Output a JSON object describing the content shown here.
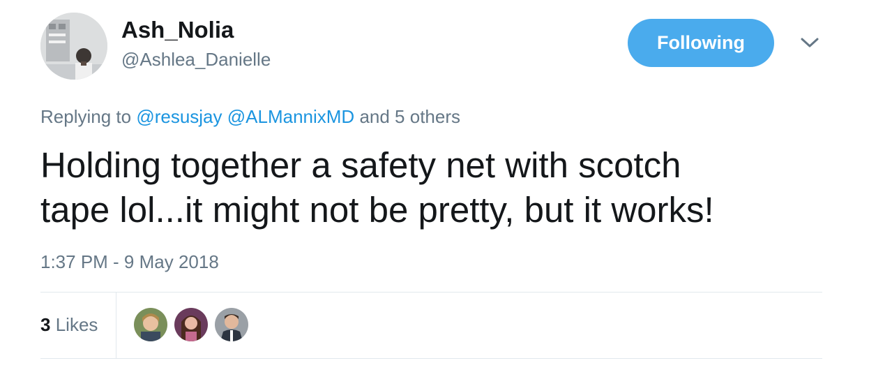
{
  "author": {
    "name": "Ash_Nolia",
    "handle": "@Ashlea_Danielle"
  },
  "follow_button": {
    "label": "Following"
  },
  "reply": {
    "prefix": "Replying to",
    "mention_1": "@resusjay",
    "mention_2": "@ALMannixMD",
    "suffix": "and 5 others"
  },
  "tweet": {
    "line_1": "Holding together a safety net with scotch",
    "line_2": "tape lol...it might not be pretty, but it works!"
  },
  "timestamp": "1:37 PM - 9 May 2018",
  "likes": {
    "count": "3",
    "label": "Likes"
  },
  "colors": {
    "accent": "#4aabed",
    "link": "#1b95e0",
    "muted": "#657786",
    "text": "#14171a"
  }
}
